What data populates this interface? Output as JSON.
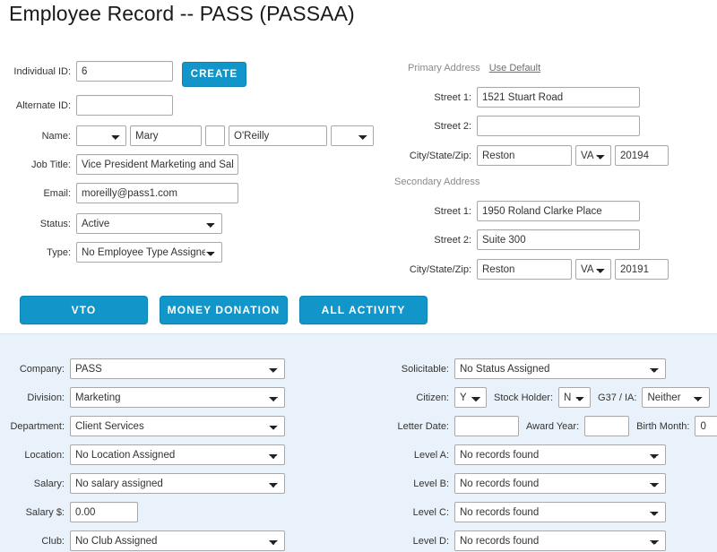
{
  "page": {
    "title": "Employee Record -- PASS (PASSAA)",
    "accent_color": "#1295c9",
    "panel_color": "#e9f2fb"
  },
  "identity": {
    "individual_id": {
      "label": "Individual ID:",
      "value": "6"
    },
    "create_button": "CREATE",
    "alternate_id": {
      "label": "Alternate ID:",
      "value": ""
    },
    "name": {
      "label": "Name:",
      "prefix": "",
      "first": "Mary",
      "middle": "",
      "last": "O'Reilly",
      "suffix": ""
    },
    "job_title": {
      "label": "Job Title:",
      "value": "Vice President Marketing and Sales"
    },
    "email": {
      "label": "Email:",
      "value": "moreilly@pass1.com"
    },
    "status": {
      "label": "Status:",
      "value": "Active"
    },
    "type": {
      "label": "Type:",
      "value": "No Employee Type Assigned"
    }
  },
  "primary_address": {
    "heading": "Primary Address",
    "use_default_link": "Use Default",
    "street1": {
      "label": "Street 1:",
      "value": "1521 Stuart Road"
    },
    "street2": {
      "label": "Street 2:",
      "value": ""
    },
    "citystatezip": {
      "label": "City/State/Zip:",
      "city": "Reston",
      "state": "VA",
      "zip": "20194"
    }
  },
  "secondary_address": {
    "heading": "Secondary Address",
    "street1": {
      "label": "Street 1:",
      "value": "1950 Roland Clarke Place"
    },
    "street2": {
      "label": "Street 2:",
      "value": "Suite 300"
    },
    "citystatezip": {
      "label": "City/State/Zip:",
      "city": "Reston",
      "state": "VA",
      "zip": "20191"
    }
  },
  "actions": {
    "vto": "VTO",
    "money_donation": "MONEY DONATION",
    "all_activity": "ALL ACTIVITY"
  },
  "details_left": {
    "company": {
      "label": "Company:",
      "value": "PASS"
    },
    "division": {
      "label": "Division:",
      "value": "Marketing"
    },
    "department": {
      "label": "Department:",
      "value": "Client Services"
    },
    "location": {
      "label": "Location:",
      "value": "No Location Assigned"
    },
    "salary": {
      "label": "Salary:",
      "value": "No salary assigned"
    },
    "salary_amount": {
      "label": "Salary $:",
      "value": "0.00"
    },
    "club": {
      "label": "Club:",
      "value": "No Club Assigned"
    }
  },
  "details_right": {
    "solicitable": {
      "label": "Solicitable:",
      "value": "No Status Assigned"
    },
    "citizen": {
      "label": "Citizen:",
      "value": "Y"
    },
    "stock_holder": {
      "label": "Stock Holder:",
      "value": "N"
    },
    "g37_ia": {
      "label": "G37 / IA:",
      "value": "Neither"
    },
    "letter_date": {
      "label": "Letter Date:",
      "value": ""
    },
    "award_year": {
      "label": "Award Year:",
      "value": ""
    },
    "birth_month": {
      "label": "Birth Month:",
      "value": "0"
    },
    "level_a": {
      "label": "Level A:",
      "value": "No records found"
    },
    "level_b": {
      "label": "Level B:",
      "value": "No records found"
    },
    "level_c": {
      "label": "Level C:",
      "value": "No records found"
    },
    "level_d": {
      "label": "Level D:",
      "value": "No records found"
    }
  }
}
